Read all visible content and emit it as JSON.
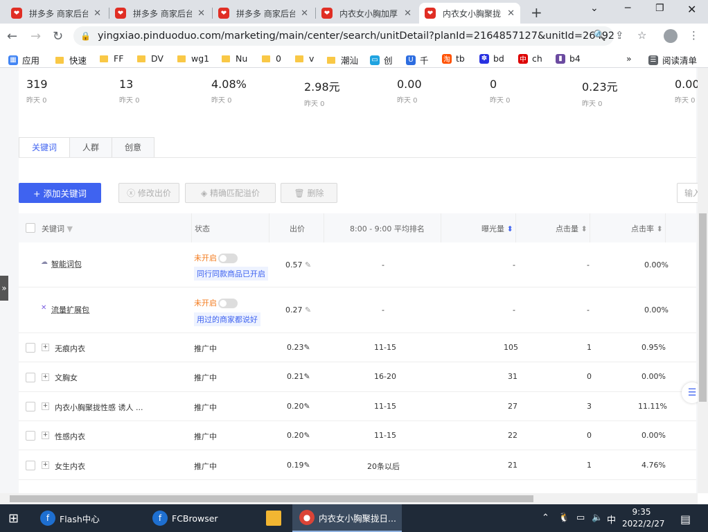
{
  "browser": {
    "tabs": [
      {
        "title": "拼多多 商家后台",
        "active": false
      },
      {
        "title": "拼多多 商家后台",
        "active": false
      },
      {
        "title": "拼多多 商家后台",
        "active": false
      },
      {
        "title": "内衣女小胸加厚",
        "active": false
      },
      {
        "title": "内衣女小胸聚拢",
        "active": true
      }
    ],
    "new_tab": "+",
    "url": "yingxiao.pinduoduo.com/marketing/main/center/search/unitDetail?planId=2164857127&unitId=26492...",
    "bookmarks": [
      "应用",
      "快速",
      "FF",
      "DV",
      "wg1",
      "Nu",
      "0",
      "v",
      "潮汕",
      "创",
      "千",
      "tb",
      "bd",
      "ch",
      "b4"
    ],
    "bookmarks_more": "»",
    "reading_list": "阅读清单"
  },
  "stats": [
    {
      "value": "319",
      "yesterday": "昨天 0"
    },
    {
      "value": "13",
      "yesterday": "昨天 0"
    },
    {
      "value": "4.08%",
      "yesterday": "昨天 0"
    },
    {
      "value": "2.98元",
      "yesterday": "昨天 0"
    },
    {
      "value": "0.00",
      "yesterday": "昨天 0"
    },
    {
      "value": "0",
      "yesterday": "昨天 0"
    },
    {
      "value": "0.23元",
      "yesterday": "昨天 0"
    },
    {
      "value": "0.00",
      "yesterday": "昨天 0"
    }
  ],
  "subtabs": [
    "关键词",
    "人群",
    "创意"
  ],
  "actions": {
    "add": "+ 添加关键词",
    "modify": "ⓧ 修改出价",
    "precise": "◈ 精确匹配溢价",
    "delete": "🗑 删除",
    "input": "输入"
  },
  "columns": {
    "keyword": "关键词",
    "status": "状态",
    "bid": "出价",
    "rank": "8:00 - 9:00 平均排名",
    "impressions": "曝光量",
    "clicks": "点击量",
    "ctr": "点击率"
  },
  "special_rows": [
    {
      "name": "智能词包",
      "status": "未开启",
      "note": "同行同款商品已开启",
      "bid": "0.57",
      "rank": "-",
      "impressions": "-",
      "clicks": "-",
      "ctr": "0.00%"
    },
    {
      "name": "流量扩展包",
      "status": "未开启",
      "note": "用过的商家都说好",
      "bid": "0.27",
      "rank": "-",
      "impressions": "-",
      "clicks": "-",
      "ctr": "0.00%"
    }
  ],
  "rows": [
    {
      "name": "无痕内衣",
      "status": "推广中",
      "bid": "0.23",
      "rank": "11-15",
      "impressions": "105",
      "clicks": "1",
      "ctr": "0.95%"
    },
    {
      "name": "文胸女",
      "status": "推广中",
      "bid": "0.21",
      "rank": "16-20",
      "impressions": "31",
      "clicks": "0",
      "ctr": "0.00%"
    },
    {
      "name": "内衣小胸聚拢性感 诱人 ...",
      "status": "推广中",
      "bid": "0.20",
      "rank": "11-15",
      "impressions": "27",
      "clicks": "3",
      "ctr": "11.11%"
    },
    {
      "name": "性感内衣",
      "status": "推广中",
      "bid": "0.20",
      "rank": "11-15",
      "impressions": "22",
      "clicks": "0",
      "ctr": "0.00%"
    },
    {
      "name": "女生内衣",
      "status": "推广中",
      "bid": "0.19",
      "rank": "20条以后",
      "impressions": "21",
      "clicks": "1",
      "ctr": "4.76%"
    }
  ],
  "taskbar": {
    "items": [
      "Flash中心",
      "FCBrowser",
      "内衣女小胸聚拢日..."
    ],
    "ime": "中",
    "time": "9:35",
    "date": "2022/2/27"
  },
  "colors": {
    "accent": "#3f63f0",
    "brand": "#e02e24",
    "warning": "#f37b1d"
  }
}
